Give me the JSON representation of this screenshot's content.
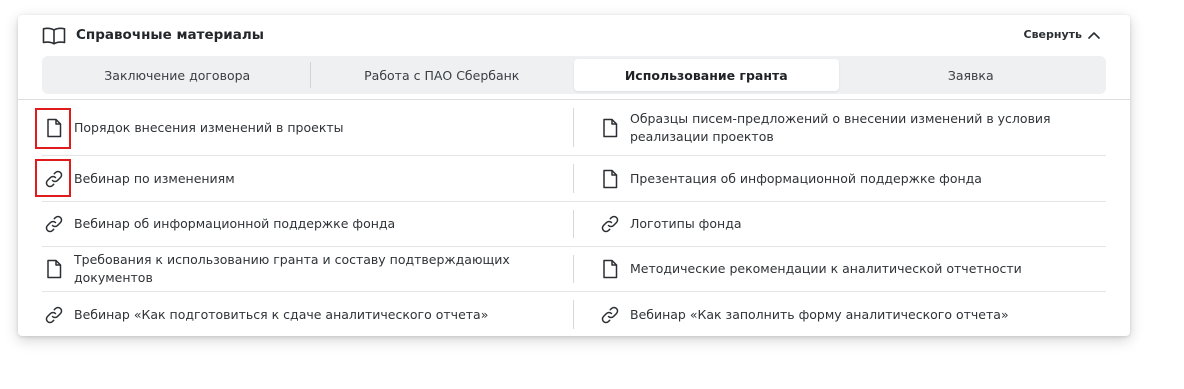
{
  "header": {
    "title": "Справочные материалы",
    "collapse_label": "Свернуть"
  },
  "tabs": [
    {
      "label": "Заключение договора",
      "active": false
    },
    {
      "label": "Работа с ПАО Сбербанк",
      "active": false
    },
    {
      "label": "Использование гранта",
      "active": true
    },
    {
      "label": "Заявка",
      "active": false
    }
  ],
  "rows": [
    {
      "left": {
        "icon": "document-icon",
        "label": "Порядок внесения изменений в проекты"
      },
      "right": {
        "icon": "document-icon",
        "label": "Образцы писем-предложений о внесении изменений в условия реализации проектов"
      }
    },
    {
      "left": {
        "icon": "link-icon",
        "label": "Вебинар по изменениям"
      },
      "right": {
        "icon": "document-icon",
        "label": "Презентация об информационной поддержке фонда"
      }
    },
    {
      "left": {
        "icon": "link-icon",
        "label": "Вебинар об информационной поддержке фонда"
      },
      "right": {
        "icon": "link-icon",
        "label": "Логотипы фонда"
      }
    },
    {
      "left": {
        "icon": "document-icon",
        "label": "Требования к использованию гранта и составу подтверждающих документов"
      },
      "right": {
        "icon": "document-icon",
        "label": "Методические рекомендации к аналитической отчетности"
      }
    },
    {
      "left": {
        "icon": "link-icon",
        "label": "Вебинар «Как подготовиться к сдаче аналитического отчета»"
      },
      "right": {
        "icon": "link-icon",
        "label": "Вебинар «Как заполнить форму аналитического отчета»"
      }
    }
  ],
  "colors": {
    "highlight": "#e01b1b",
    "tab_bar_bg": "#eef0f2",
    "text": "#2f3337"
  }
}
